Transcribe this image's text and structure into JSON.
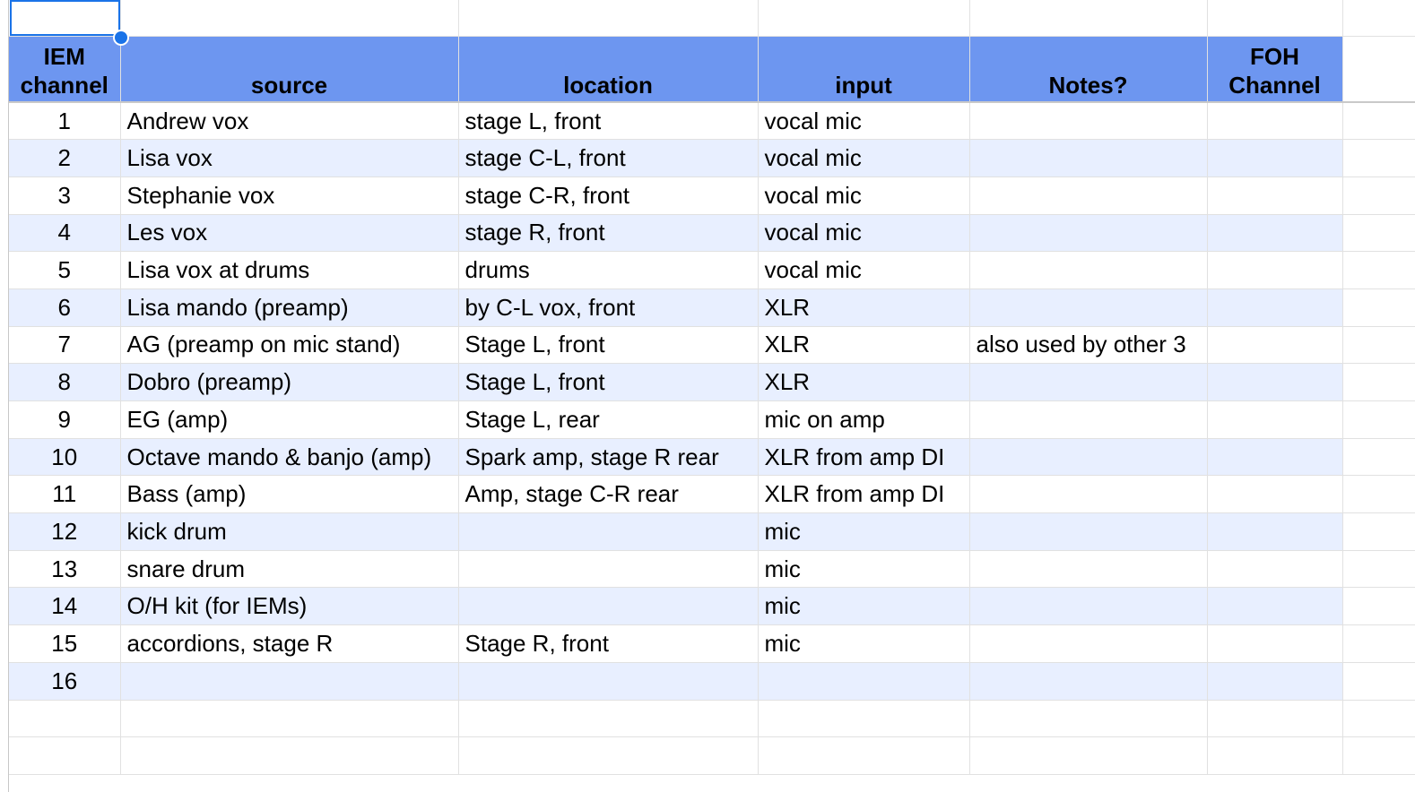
{
  "headers": [
    "IEM channel",
    "source",
    "location",
    "input",
    "Notes?",
    "FOH Channel"
  ],
  "rows": [
    {
      "ch": "1",
      "source": "Andrew vox",
      "location": "stage L, front",
      "input": "vocal mic",
      "notes": "",
      "foh": ""
    },
    {
      "ch": "2",
      "source": "Lisa vox",
      "location": "stage C-L, front",
      "input": "vocal mic",
      "notes": "",
      "foh": ""
    },
    {
      "ch": "3",
      "source": "Stephanie vox",
      "location": "stage C-R, front",
      "input": "vocal mic",
      "notes": "",
      "foh": ""
    },
    {
      "ch": "4",
      "source": "Les vox",
      "location": "stage R, front",
      "input": "vocal mic",
      "notes": "",
      "foh": ""
    },
    {
      "ch": "5",
      "source": "Lisa vox at drums",
      "location": "drums",
      "input": "vocal mic",
      "notes": "",
      "foh": ""
    },
    {
      "ch": "6",
      "source": "Lisa mando (preamp)",
      "location": "by C-L vox, front",
      "input": "XLR",
      "notes": "",
      "foh": ""
    },
    {
      "ch": "7",
      "source": "AG (preamp on mic stand)",
      "location": "Stage L, front",
      "input": "XLR",
      "notes": "also used by other 3",
      "foh": ""
    },
    {
      "ch": "8",
      "source": "Dobro (preamp)",
      "location": "Stage L, front",
      "input": "XLR",
      "notes": "",
      "foh": ""
    },
    {
      "ch": "9",
      "source": "EG (amp)",
      "location": "Stage L, rear",
      "input": "mic on amp",
      "notes": "",
      "foh": ""
    },
    {
      "ch": "10",
      "source": "Octave mando & banjo (amp)",
      "location": "Spark amp, stage R rear",
      "input": "XLR from amp DI",
      "notes": "",
      "foh": ""
    },
    {
      "ch": "11",
      "source": "Bass (amp)",
      "location": "Amp, stage C-R rear",
      "input": "XLR from amp DI",
      "notes": "",
      "foh": ""
    },
    {
      "ch": "12",
      "source": "kick drum",
      "location": "",
      "input": "mic",
      "notes": "",
      "foh": ""
    },
    {
      "ch": "13",
      "source": "snare drum",
      "location": "",
      "input": "mic",
      "notes": "",
      "foh": ""
    },
    {
      "ch": "14",
      "source": "O/H kit (for IEMs)",
      "location": "",
      "input": "mic",
      "notes": "",
      "foh": ""
    },
    {
      "ch": "15",
      "source": "accordions, stage R",
      "location": "Stage R, front",
      "input": "mic",
      "notes": "",
      "foh": ""
    },
    {
      "ch": "16",
      "source": "",
      "location": "",
      "input": "",
      "notes": "",
      "foh": ""
    }
  ],
  "colors": {
    "header_bg": "#6d96f0",
    "band_bg": "#e8efff",
    "selection": "#1a73e8",
    "grid": "#e1e1e1"
  }
}
